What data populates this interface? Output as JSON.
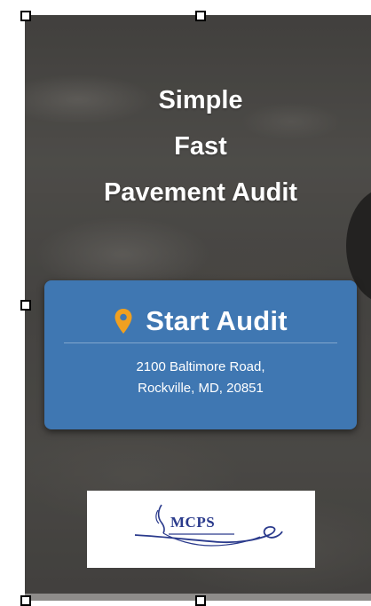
{
  "tagline": {
    "line1": "Simple",
    "line2": "Fast",
    "line3": "Pavement Audit"
  },
  "audit_card": {
    "icon": "map-pin-icon",
    "title": "Start Audit",
    "address_line1": "2100 Baltimore Road,",
    "address_line2": "Rockville, MD, 20851"
  },
  "logo": {
    "text": "MCPS"
  },
  "colors": {
    "card_blue": "#3f77b2",
    "pin_orange": "#f0a020",
    "logo_navy": "#2a3a8c"
  }
}
